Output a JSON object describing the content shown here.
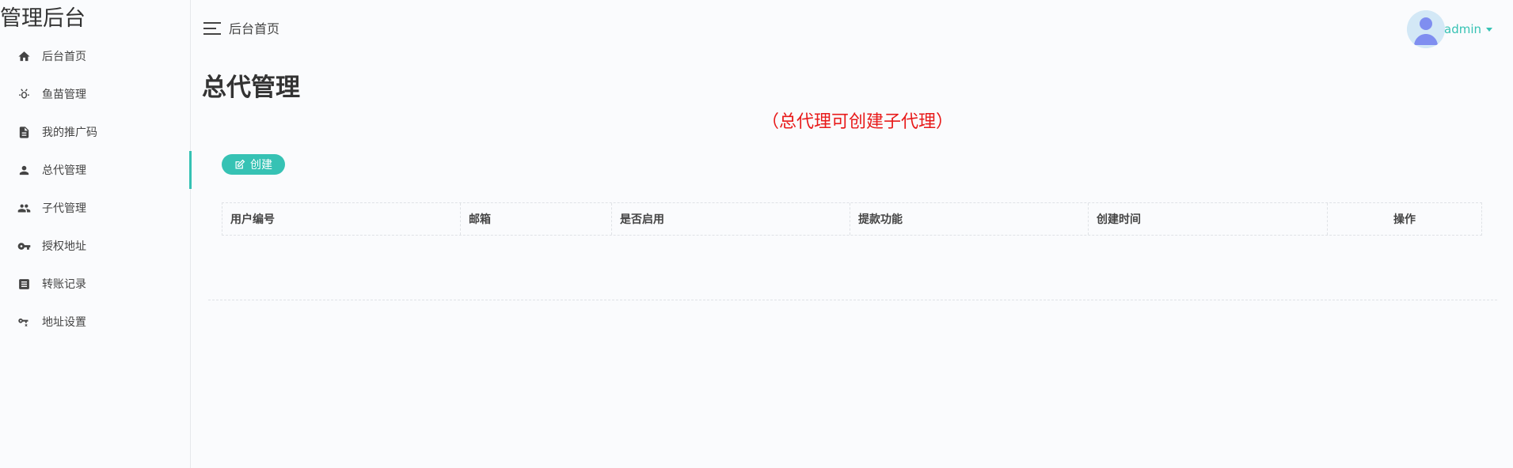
{
  "app": {
    "logo": "管理后台"
  },
  "sidebar": {
    "items": [
      {
        "label": "后台首页",
        "icon": "home-icon",
        "active": false
      },
      {
        "label": "鱼苗管理",
        "icon": "bug-icon",
        "active": false
      },
      {
        "label": "我的推广码",
        "icon": "document-icon",
        "active": false
      },
      {
        "label": "总代管理",
        "icon": "person-icon",
        "active": true
      },
      {
        "label": "子代管理",
        "icon": "people-icon",
        "active": false
      },
      {
        "label": "授权地址",
        "icon": "key-icon",
        "active": false
      },
      {
        "label": "转账记录",
        "icon": "list-icon",
        "active": false
      },
      {
        "label": "地址设置",
        "icon": "key-x-icon",
        "active": false
      }
    ]
  },
  "header": {
    "breadcrumb": "后台首页",
    "username": "admin"
  },
  "main": {
    "title": "总代管理",
    "notice": "（总代理可创建子代理）",
    "create_label": "创建",
    "table": {
      "columns": [
        "用户编号",
        "邮箱",
        "是否启用",
        "提款功能",
        "创建时间",
        "操作"
      ],
      "rows": []
    }
  },
  "colors": {
    "accent": "#36c2b4",
    "notice": "#e81a1a"
  }
}
